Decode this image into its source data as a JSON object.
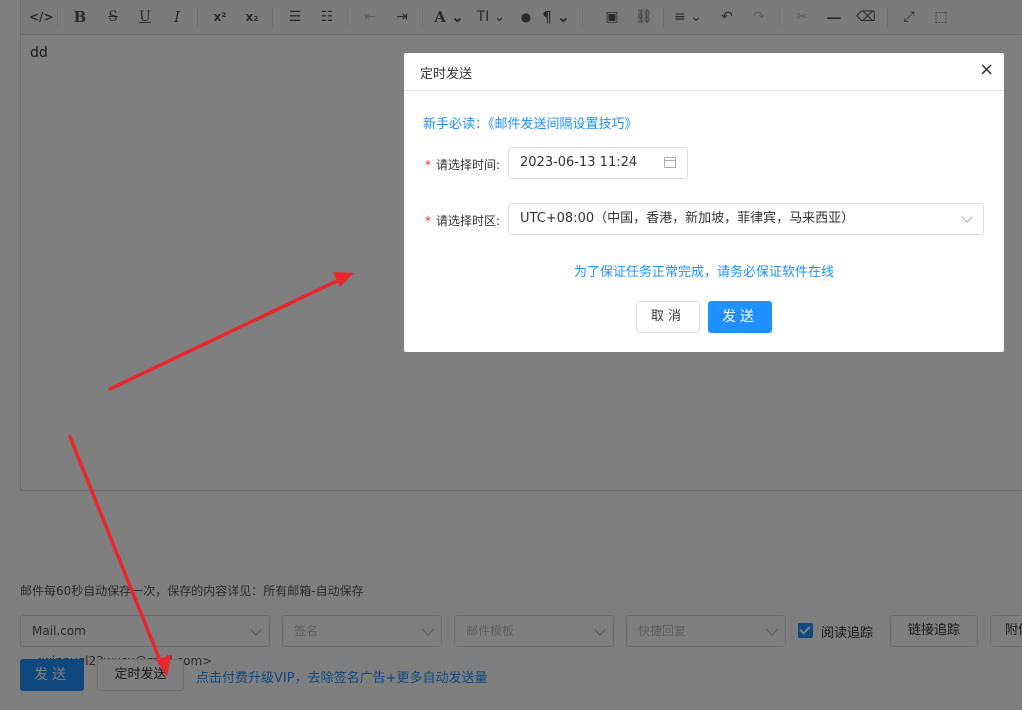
{
  "toolbar": {
    "items": [
      {
        "name": "source-code-icon",
        "glyph": "</>"
      },
      {
        "name": "bold-icon",
        "glyph": "B"
      },
      {
        "name": "strikethrough-icon",
        "glyph": "S"
      },
      {
        "name": "underline-icon",
        "glyph": "U"
      },
      {
        "name": "italic-icon",
        "glyph": "I"
      },
      {
        "name": "superscript-icon",
        "glyph": "x²"
      },
      {
        "name": "subscript-icon",
        "glyph": "x₂"
      },
      {
        "name": "bullet-list-icon",
        "glyph": "☰"
      },
      {
        "name": "numbered-list-icon",
        "glyph": "☷"
      },
      {
        "name": "outdent-icon",
        "glyph": "⇤"
      },
      {
        "name": "indent-icon",
        "glyph": "⇥"
      },
      {
        "name": "font-color-icon",
        "glyph": "A ⌄"
      },
      {
        "name": "font-size-icon",
        "glyph": "TI ⌄"
      },
      {
        "name": "background-color-icon",
        "glyph": "●"
      },
      {
        "name": "paragraph-icon",
        "glyph": "¶ ⌄"
      },
      {
        "name": "image-icon",
        "glyph": "▣"
      },
      {
        "name": "link-icon",
        "glyph": "⛓"
      },
      {
        "name": "align-icon",
        "glyph": "≡ ⌄"
      },
      {
        "name": "undo-icon",
        "glyph": "↶"
      },
      {
        "name": "redo-icon",
        "glyph": "↷"
      },
      {
        "name": "cut-icon",
        "glyph": "✂"
      },
      {
        "name": "horizontal-rule-icon",
        "glyph": "—"
      },
      {
        "name": "eraser-icon",
        "glyph": "⌫"
      },
      {
        "name": "fullscreen-icon",
        "glyph": "⤢"
      },
      {
        "name": "select-all-icon",
        "glyph": "⬚"
      }
    ]
  },
  "editor": {
    "content": "dd"
  },
  "autosave_note": "邮件每60秒自动保存一次，保存的内容详见：所有邮箱-自动保存",
  "options": {
    "sender_value": "Mail.com <winnyql22wusu@mail.com>",
    "signature_placeholder": "签名",
    "template_placeholder": "邮件模板",
    "quick_reply_placeholder": "快捷回复",
    "read_tracking_label": "阅读追踪",
    "read_tracking_checked": true,
    "link_tracking_label": "链接追踪",
    "attachment_label": "附件"
  },
  "actions": {
    "send_label": "发送",
    "schedule_label": "定时发送",
    "vip_link": "点击付费升级VIP，去除签名广告+更多自动发送量"
  },
  "dialog": {
    "title": "定时发送",
    "close_glyph": "×",
    "guide_link": "新手必读：《邮件发送间隔设置技巧》",
    "time_label": "请选择时间:",
    "time_value": "2023-06-13 11:24",
    "timezone_label": "请选择时区:",
    "timezone_value": "UTC+08:00（中国，香港，新加坡，菲律宾，马来西亚）",
    "notice": "为了保证任务正常完成，请务必保证软件在线",
    "cancel_label": "取消",
    "send_label": "发送",
    "required_mark": "*"
  },
  "colors": {
    "primary": "#1e90ff",
    "required": "#f5222d",
    "annotation_arrow": "#e8262b"
  }
}
